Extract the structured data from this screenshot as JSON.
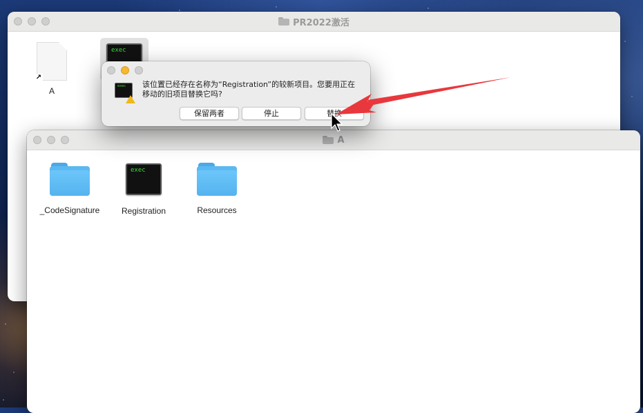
{
  "desktop": {},
  "window_back": {
    "title": "PR2022激活",
    "items": [
      {
        "label": "A",
        "type": "alias-document"
      },
      {
        "label": "",
        "type": "exec",
        "icon_text": "exec"
      }
    ]
  },
  "dialog": {
    "message": "该位置已经存在名称为“Registration”的较新项目。您要用正在移动的旧项目替换它吗?",
    "icon_text": "exec",
    "buttons": {
      "keep_both": "保留两者",
      "stop": "停止",
      "replace": "替换"
    }
  },
  "window_front": {
    "title": "A",
    "items": [
      {
        "label": "_CodeSignature",
        "type": "folder"
      },
      {
        "label": "Registration",
        "type": "exec",
        "icon_text": "exec"
      },
      {
        "label": "Resources",
        "type": "folder"
      }
    ]
  },
  "colors": {
    "arrow": "#e8383d",
    "folder": "#5cb8f0",
    "exec_text": "#3ddc3d",
    "warning": "#f1b81c"
  }
}
